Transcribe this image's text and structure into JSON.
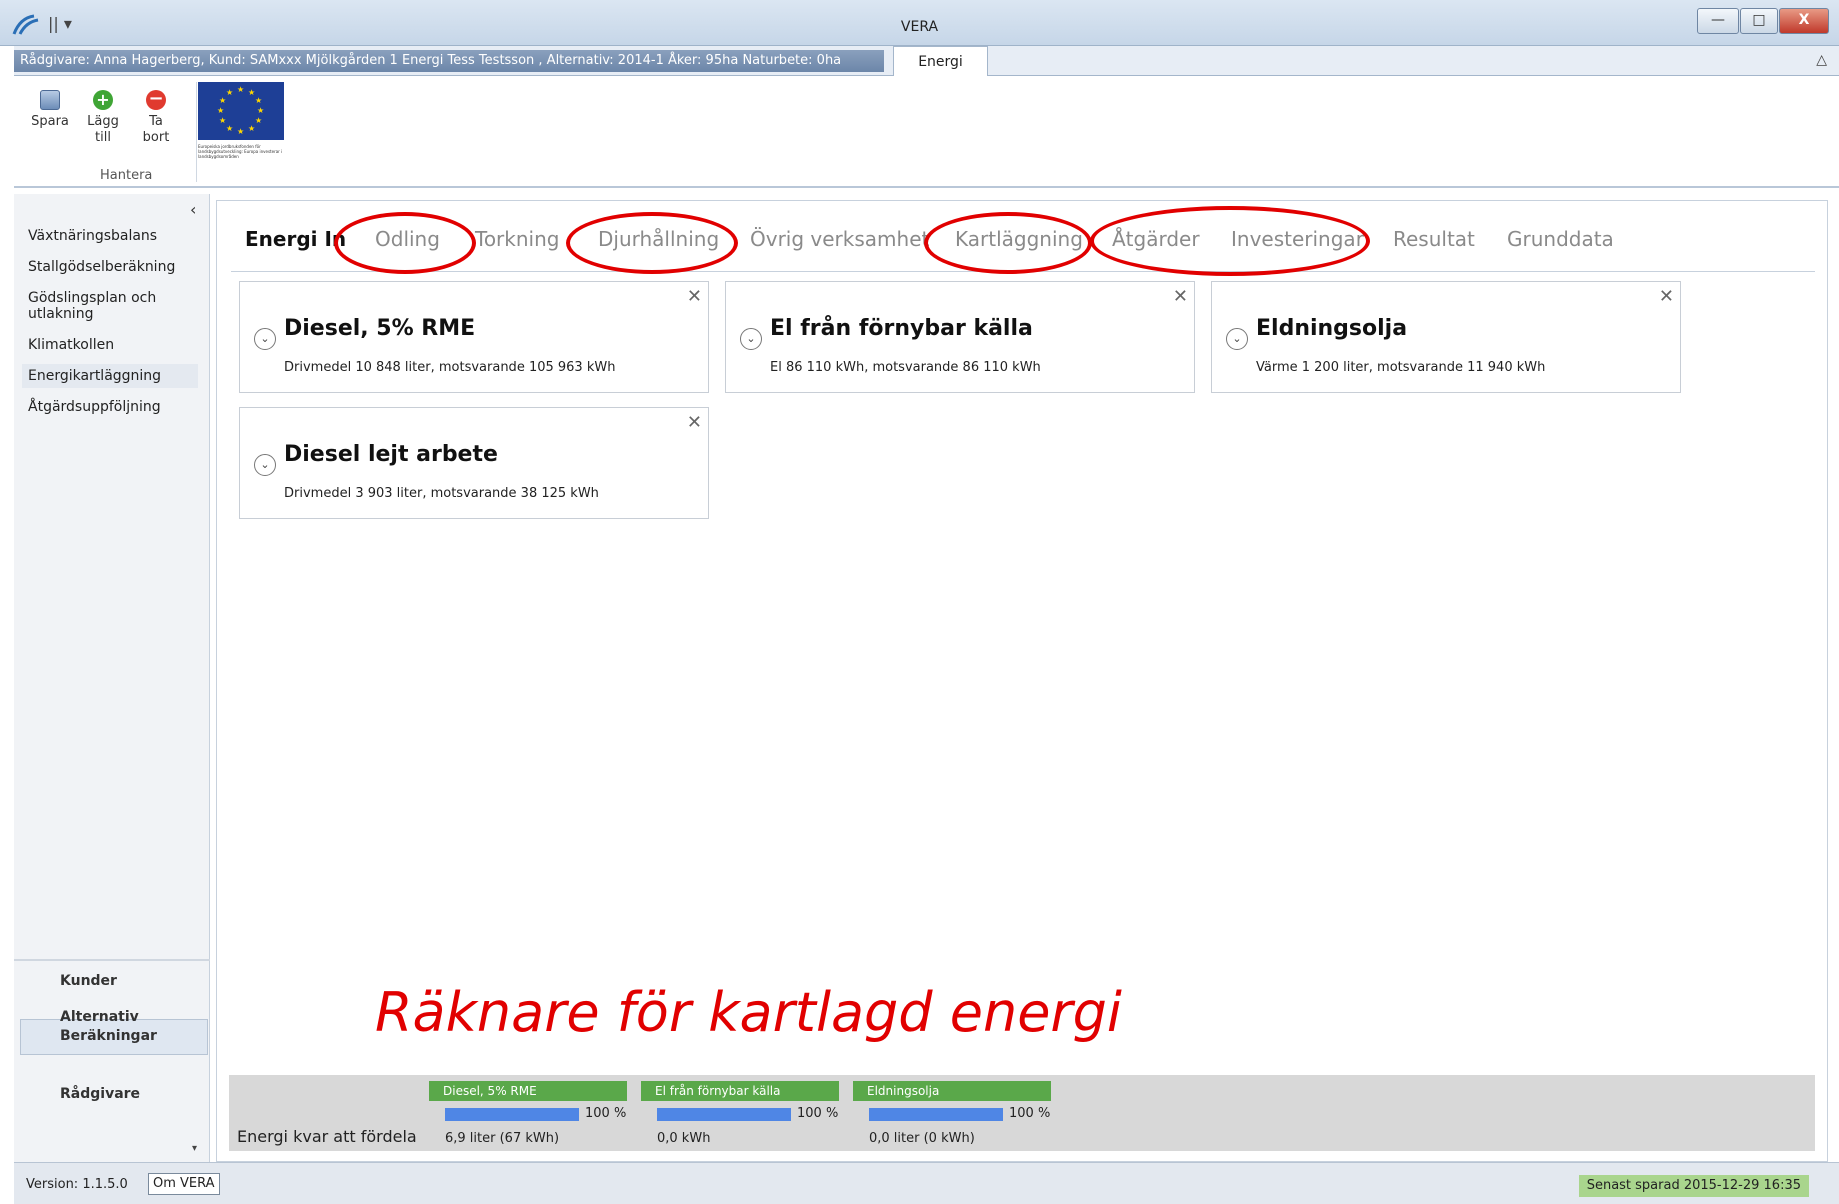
{
  "window": {
    "title": "VERA",
    "quick_access": "|| ▾",
    "minimize": "—",
    "maximize": "□",
    "close": "X"
  },
  "context_bar": {
    "text": "Rådgivare: Anna Hagerberg, Kund: SAMxxx Mjölkgården 1 Energi Tess Testsson , Alternativ: 2014-1 Åker: 95ha Naturbete: 0ha",
    "ribbon_tab": "Energi",
    "collapse": "△"
  },
  "ribbon": {
    "save_label": "Spara",
    "add_label_1": "Lägg",
    "add_label_2": "till",
    "remove_label_1": "Ta",
    "remove_label_2": "bort",
    "group_label": "Hantera",
    "add_icon": "+",
    "remove_icon": "−",
    "eu_text": "Europeiska jordbruksfonden för landsbygdsutveckling: Europa investerar i landsbygdsområden"
  },
  "sidebar": {
    "collapse": "‹",
    "items": [
      {
        "label": "Växtnäringsbalans"
      },
      {
        "label": "Stallgödselberäkning"
      },
      {
        "label": "Gödslingsplan och utlakning"
      },
      {
        "label": "Klimatkollen"
      },
      {
        "label": "Energikartläggning"
      },
      {
        "label": "Åtgärdsuppföljning"
      }
    ],
    "bottom": [
      {
        "label": "Kunder"
      },
      {
        "label": "Alternativ"
      },
      {
        "label": "Beräkningar"
      },
      {
        "label": "Rådgivare"
      }
    ],
    "expand": "▾"
  },
  "tabs": [
    {
      "label": "Energi In"
    },
    {
      "label": "Odling"
    },
    {
      "label": "Torkning"
    },
    {
      "label": "Djurhållning"
    },
    {
      "label": "Övrig verksamhet"
    },
    {
      "label": "Kartläggning"
    },
    {
      "label": "Åtgärder"
    },
    {
      "label": "Investeringar"
    },
    {
      "label": "Resultat"
    },
    {
      "label": "Grunddata"
    }
  ],
  "cards": [
    {
      "title": "Diesel, 5% RME",
      "detail": "Drivmedel 10 848 liter, motsvarande 105 963 kWh"
    },
    {
      "title": "El från förnybar källa",
      "detail": "El 86 110 kWh, motsvarande 86 110 kWh"
    },
    {
      "title": "Eldningsolja",
      "detail": "Värme 1 200 liter, motsvarande 11 940 kWh"
    },
    {
      "title": "Diesel lejt arbete",
      "detail": "Drivmedel 3 903 liter, motsvarande 38 125 kWh"
    }
  ],
  "card_icons": {
    "close": "✕",
    "expand": "⌄"
  },
  "annotation": "Räknare för kartlagd energi",
  "counter_bar": {
    "label": "Energi kvar att fördela",
    "counters": [
      {
        "name": "Diesel, 5% RME",
        "percent_label": "100 %",
        "fill_fraction": 1.0,
        "remaining": "6,9 liter (67 kWh)"
      },
      {
        "name": "El från förnybar källa",
        "percent_label": "100 %",
        "fill_fraction": 1.0,
        "remaining": "0,0 kWh"
      },
      {
        "name": "Eldningsolja",
        "percent_label": "100 %",
        "fill_fraction": 1.0,
        "remaining": "0,0 liter (0 kWh)"
      }
    ]
  },
  "statusbar": {
    "version": "Version: 1.1.5.0",
    "about": "Om VERA",
    "saved": "Senast sparad 2015-12-29 16:35"
  },
  "colors": {
    "highlight_ring": "#e10000",
    "counter_header": "#5aa84a",
    "counter_fill": "#4f86e5",
    "saved_badge": "#a9d58d"
  }
}
